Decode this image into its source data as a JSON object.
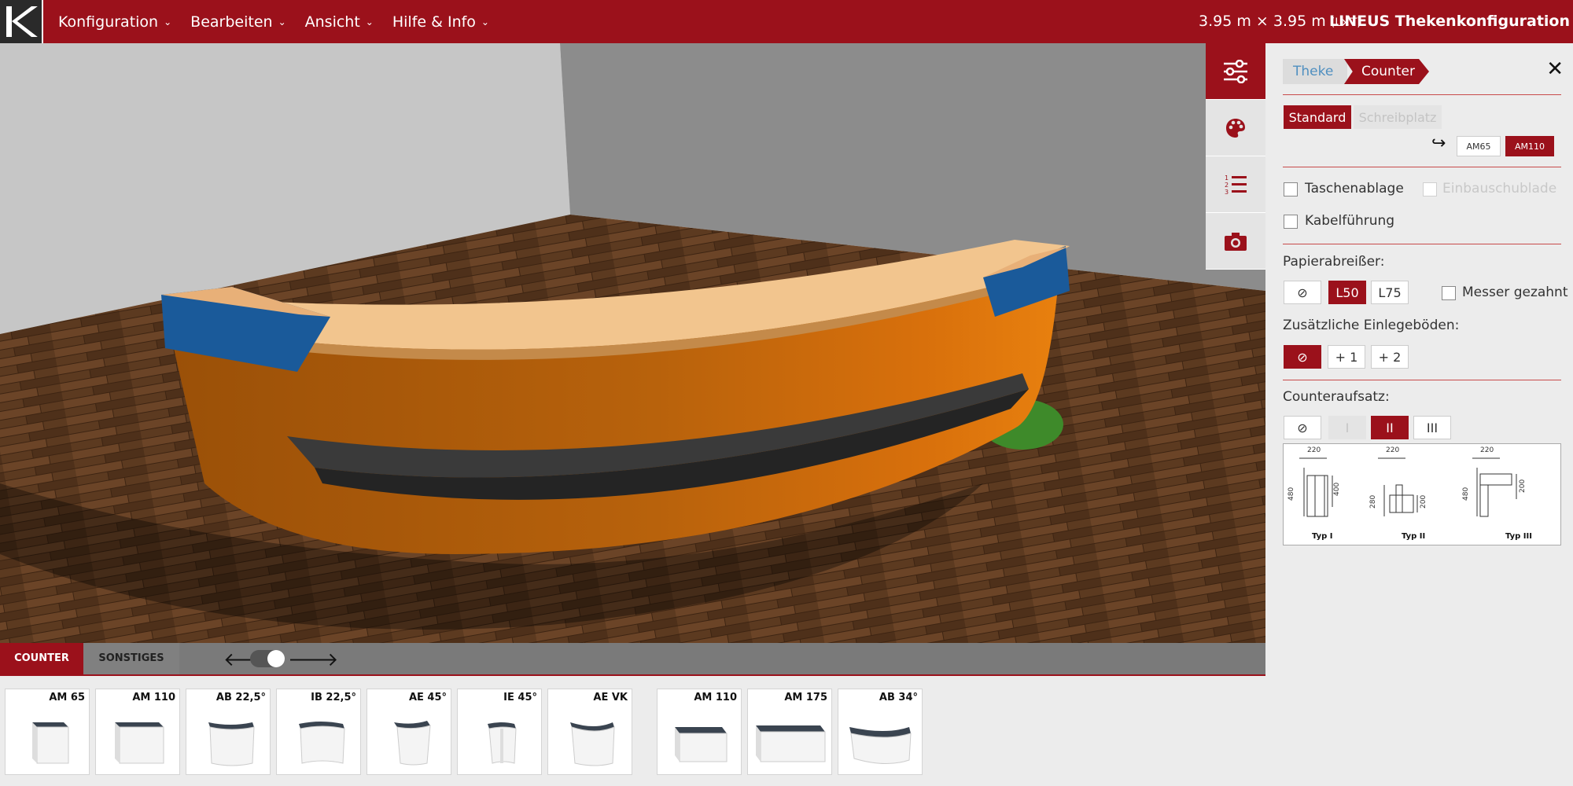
{
  "header": {
    "menu": [
      {
        "label": "Konfiguration"
      },
      {
        "label": "Bearbeiten"
      },
      {
        "label": "Ansicht"
      },
      {
        "label": "Hilfe & Info"
      }
    ],
    "dimensions": "3.95 m × 3.95 m",
    "dimensions_unit": "(L×T)",
    "title": "LINEUS Thekenkonfiguration"
  },
  "colors": {
    "brand": "#9b111b",
    "counter_body": "#d8700c",
    "counter_top": "#f0c088",
    "end_caps": "#1a5a9a",
    "footrest": "#3a3a3a",
    "floor": "#5e3a20"
  },
  "tools": [
    {
      "icon": "sliders-icon"
    },
    {
      "icon": "palette-icon"
    },
    {
      "icon": "numbered-list-icon"
    },
    {
      "icon": "camera-icon"
    }
  ],
  "tabs": {
    "counter": "COUNTER",
    "misc": "SONSTIGES",
    "prev_arrow": "🡐",
    "next_arrow": "🡒"
  },
  "parts": [
    {
      "label": "AM 65"
    },
    {
      "label": "AM 110"
    },
    {
      "label": "AB 22,5°"
    },
    {
      "label": "IB 22,5°"
    },
    {
      "label": "AE 45°"
    },
    {
      "label": "IE 45°"
    },
    {
      "label": "AE VK"
    },
    {
      "label": "AM 110"
    },
    {
      "label": "AM 175"
    },
    {
      "label": "AB 34°"
    }
  ],
  "panel": {
    "breadcrumb": [
      "Theke",
      "Counter"
    ],
    "close": "✕",
    "type_buttons": {
      "standard": "Standard",
      "desk": "Schreibplatz"
    },
    "enter_arrow": "↪",
    "size_buttons": {
      "am65": "AM65",
      "am110": "AM110"
    },
    "options": {
      "bag_shelf": "Taschenablage",
      "drawer": "Einbauschublade",
      "cable": "Kabelführung"
    },
    "paper": {
      "label": "Papierabreißer:",
      "none": "⊘",
      "l50": "L50",
      "l75": "L75",
      "serrated": "Messer gezahnt"
    },
    "shelves": {
      "label": "Zusätzliche Einlegeböden:",
      "none": "⊘",
      "plus1": "+ 1",
      "plus2": "+ 2"
    },
    "topper": {
      "label": "Counteraufsatz:",
      "none": "⊘",
      "t1": "I",
      "t2": "II",
      "t3": "III"
    },
    "diagram": {
      "captions": [
        "Typ I",
        "Typ II",
        "Typ III"
      ],
      "dims_top": [
        "220",
        "220",
        "220"
      ],
      "dims_i": [
        "480",
        "400"
      ],
      "dims_ii": [
        "280",
        "200"
      ],
      "dims_iii": [
        "480",
        "200"
      ]
    }
  }
}
